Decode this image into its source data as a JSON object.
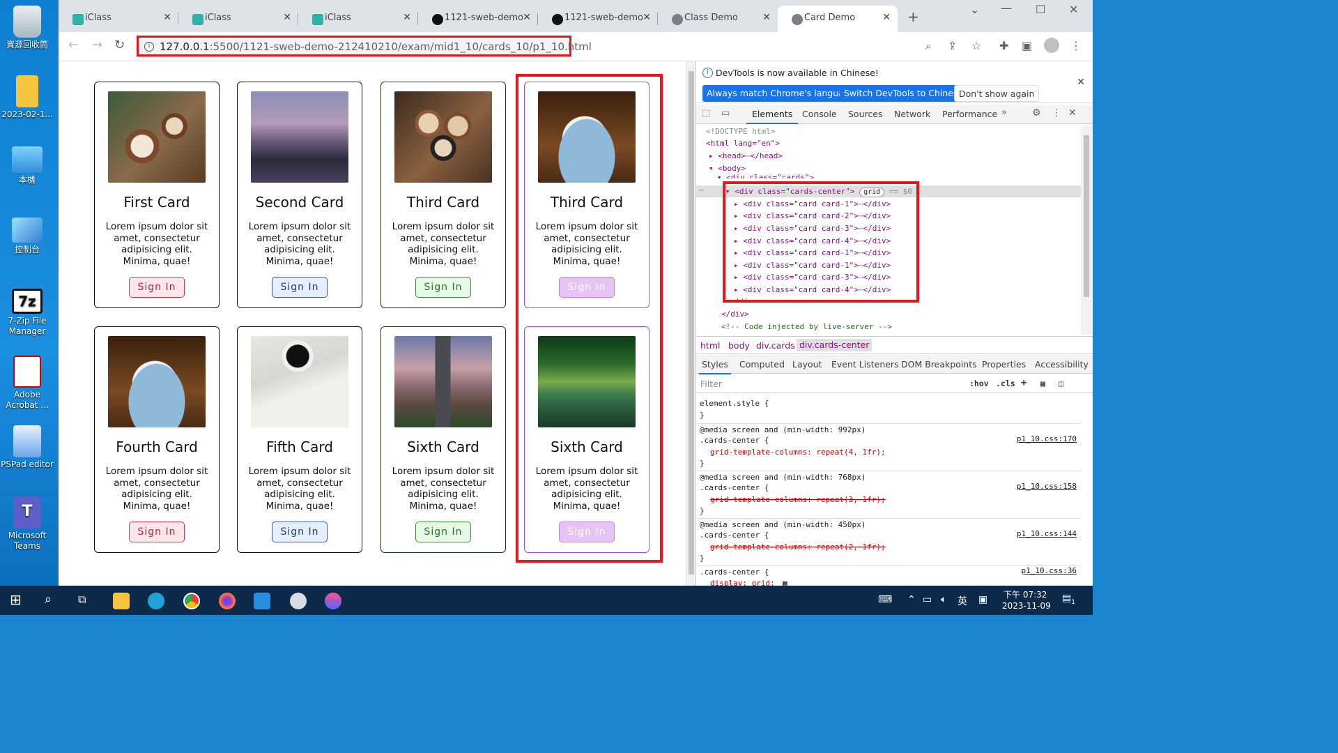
{
  "desktop": {
    "icons": [
      {
        "label": "資源回收筒"
      },
      {
        "label": "2023-02-1..."
      },
      {
        "label": "本機"
      },
      {
        "label": "控制台"
      },
      {
        "label": "7-Zip File Manager"
      },
      {
        "label": "Adobe Acrobat ..."
      },
      {
        "label": "PSPad editor"
      },
      {
        "label": "Microsoft Teams"
      }
    ]
  },
  "browser": {
    "tabs": [
      {
        "title": "iClass"
      },
      {
        "title": "iClass"
      },
      {
        "title": "iClass"
      },
      {
        "title": "1121-sweb-demo"
      },
      {
        "title": "1121-sweb-demo"
      },
      {
        "title": "Class Demo"
      },
      {
        "title": "Card Demo"
      }
    ],
    "new_tab": "+",
    "url_host": "127.0.0.1",
    "url_path": ":5500/1121-sweb-demo-212410210/exam/mid1_10/cards_10/p1_10.html"
  },
  "page": {
    "cards": [
      {
        "title": "First Card",
        "text": "Lorem ipsum dolor sit amet, consectetur adipisicing elit. Minima, quae!",
        "button": "Sign In"
      },
      {
        "title": "Second Card",
        "text": "Lorem ipsum dolor sit amet, consectetur adipisicing elit. Minima, quae!",
        "button": "Sign In"
      },
      {
        "title": "Third Card",
        "text": "Lorem ipsum dolor sit amet, consectetur adipisicing elit. Minima, quae!",
        "button": "Sign In"
      },
      {
        "title": "Third Card",
        "text": "Lorem ipsum dolor sit amet, consectetur adipisicing elit. Minima, quae!",
        "button": "Sign In"
      },
      {
        "title": "Fourth Card",
        "text": "Lorem ipsum dolor sit amet, consectetur adipisicing elit. Minima, quae!",
        "button": "Sign In"
      },
      {
        "title": "Fifth Card",
        "text": "Lorem ipsum dolor sit amet, consectetur adipisicing elit. Minima, quae!",
        "button": "Sign In"
      },
      {
        "title": "Sixth Card",
        "text": "Lorem ipsum dolor sit amet, consectetur adipisicing elit. Minima, quae!",
        "button": "Sign In"
      },
      {
        "title": "Sixth Card",
        "text": "Lorem ipsum dolor sit amet, consectetur adipisicing elit. Minima, quae!",
        "button": "Sign In"
      }
    ]
  },
  "devtools": {
    "notice": "DevTools is now available in Chinese!",
    "btn_match": "Always match Chrome's language",
    "btn_switch": "Switch DevTools to Chinese",
    "btn_dont": "Don't show again",
    "tabs": [
      "Elements",
      "Console",
      "Sources",
      "Network",
      "Performance"
    ],
    "dom": {
      "doctype": "<!DOCTYPE html>",
      "html_open": "<html lang=\"en\">",
      "head": "<head>",
      "head_close": "</head>",
      "body": "<body>",
      "cards_div": "<div class=\"cards\">",
      "center_div": "<div class=\"cards-center\">",
      "grid_badge": "grid",
      "eq": "== $0",
      "children": [
        "<div class=\"card card-1\">",
        "<div class=\"card card-2\">",
        "<div class=\"card card-3\">",
        "<div class=\"card card-4\">",
        "<div class=\"card card-1\">",
        "<div class=\"card card-1\">",
        "<div class=\"card card-3\">",
        "<div class=\"card card-4\">"
      ],
      "child_close": "</div>",
      "div_close": "</div>",
      "div_close2": "</div>",
      "comment": "<!-- Code injected by live-server -->"
    },
    "breadcrumbs": [
      "html",
      "body",
      "div.cards",
      "div.cards-center"
    ],
    "style_tabs": [
      "Styles",
      "Computed",
      "Layout",
      "Event Listeners",
      "DOM Breakpoints",
      "Properties",
      "Accessibility"
    ],
    "filter_placeholder": "Filter",
    "hov": ":hov",
    "cls": ".cls",
    "rules": {
      "element_style": "element.style {",
      "close": "}",
      "r1_media": "@media screen and (min-width: 992px)",
      "r1_sel": ".cards-center {",
      "r1_prop": "grid-template-columns: repeat(4, 1fr);",
      "r1_src": "p1_10.css:170",
      "r2_media": "@media screen and (min-width: 768px)",
      "r2_sel": ".cards-center {",
      "r2_prop": "grid-template-columns: repeat(3, 1fr);",
      "r2_src": "p1_10.css:158",
      "r3_media": "@media screen and (min-width: 450px)",
      "r3_sel": ".cards-center {",
      "r3_prop": "grid-template-columns: repeat(2, 1fr);",
      "r3_src": "p1_10.css:144",
      "r4_sel": ".cards-center {",
      "r4_prop": "display: grid;",
      "r4_src": "p1_10.css:36"
    }
  },
  "taskbar": {
    "time": "下午 07:32",
    "date": "2023-11-09",
    "ime": "英",
    "notif": "1"
  }
}
